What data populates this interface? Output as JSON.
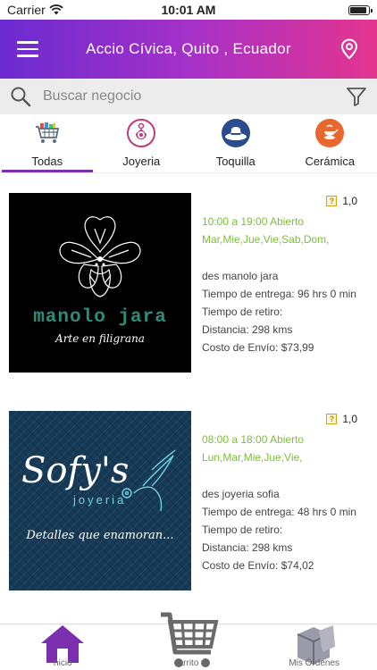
{
  "status_bar": {
    "carrier": "Carrier",
    "time": "10:01 AM",
    "battery_level": 0.9
  },
  "header": {
    "title": "Accio Cívica, Quito , Ecuador",
    "menu_icon": "hamburger-menu-icon",
    "location_icon": "location-pin-icon"
  },
  "search": {
    "placeholder": "Buscar negocio",
    "value": "",
    "search_icon": "magnifier-icon",
    "filter_icon": "funnel-filter-icon"
  },
  "categories": [
    {
      "label": "Todas",
      "icon": "shopping-cart-icon",
      "active": true
    },
    {
      "label": "Joyeria",
      "icon": "jewelry-icon",
      "active": false
    },
    {
      "label": "Toquilla",
      "icon": "hat-icon",
      "active": false
    },
    {
      "label": "Cerámica",
      "icon": "ceramic-icon",
      "active": false
    }
  ],
  "stores": [
    {
      "logo_text": "manolo jara",
      "logo_tagline": "Arte en filigrana",
      "rating": "1,0",
      "hours": "10:00 a 19:00 Abierto",
      "days": "Mar,Mie,Jue,Vie,Sab,Dom,",
      "description": "des manolo jara",
      "delivery_time_label": "Tiempo de entrega: 96 hrs 0 min",
      "pickup_time_label": "Tiempo de retiro:",
      "distance_label": "Distancia: 298 kms",
      "shipping_cost_label": "Costo de Envío: $73,99"
    },
    {
      "logo_text": "Sofy's",
      "logo_subtext": "joyeria",
      "logo_tagline": "Detalles que enamoran...",
      "rating": "1,0",
      "hours": "08:00 a 18:00 Abierto",
      "days": "Lun,Mar,Mie,Jue,Vie,",
      "description": "des joyeria sofia",
      "delivery_time_label": "Tiempo de entrega: 48 hrs 0 min",
      "pickup_time_label": "Tiempo de retiro:",
      "distance_label": "Distancia: 298 kms",
      "shipping_cost_label": "Costo de Envío: $74,02"
    }
  ],
  "tab_bar": {
    "items": [
      {
        "label": "nicio",
        "icon": "home-icon",
        "active": true
      },
      {
        "label": "arrito",
        "icon": "cart-icon",
        "active": false
      },
      {
        "label": "Mis Órdenes",
        "icon": "boxes-icon",
        "active": false
      }
    ]
  },
  "colors": {
    "header_start": "#6a2bd0",
    "header_end": "#e4358f",
    "accent_purple": "#7b2fae",
    "open_green": "#7bbf3a"
  }
}
